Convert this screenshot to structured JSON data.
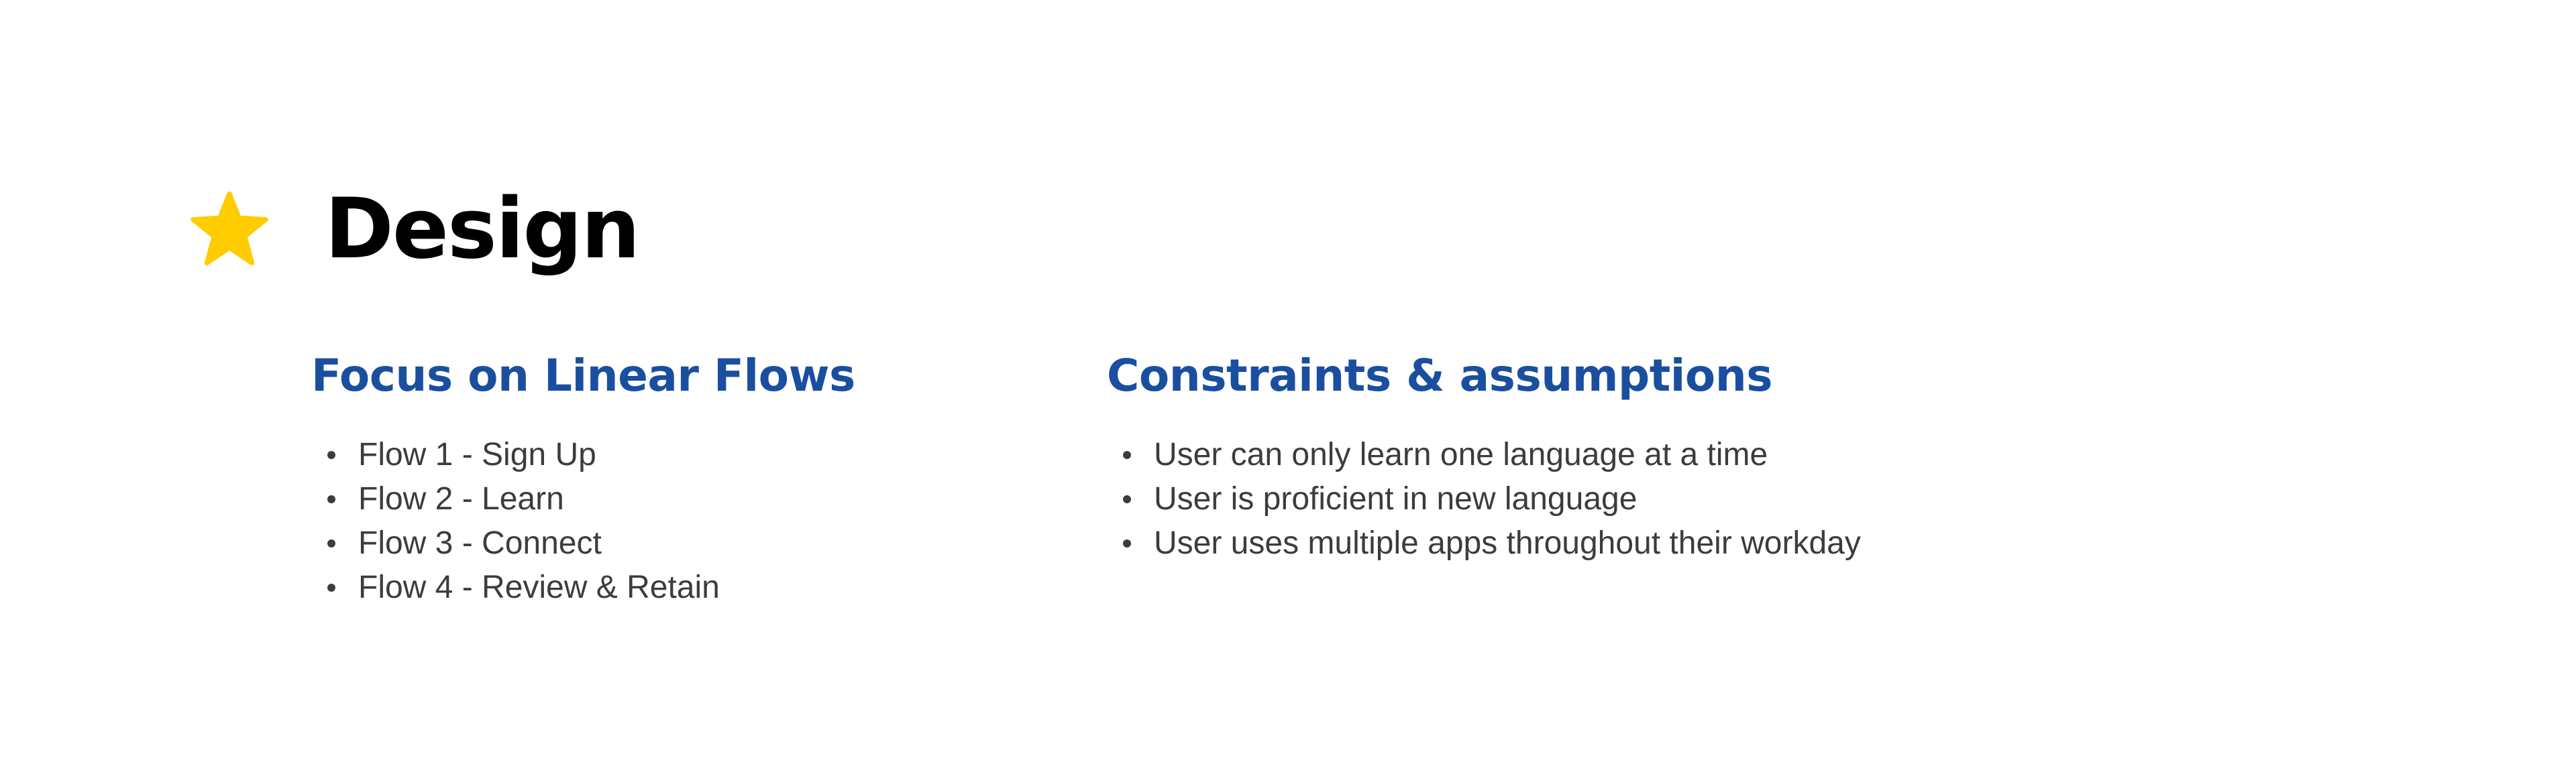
{
  "header": {
    "icon": "star-icon",
    "icon_color": "#FFCC00",
    "title": "Design"
  },
  "sections": [
    {
      "heading": "Focus on Linear Flows",
      "heading_color": "#1A4FA0",
      "items": [
        "Flow 1 - Sign Up",
        "Flow 2 - Learn",
        "Flow 3 - Connect",
        "Flow 4 - Review & Retain"
      ]
    },
    {
      "heading": "Constraints & assumptions",
      "heading_color": "#1A4FA0",
      "items": [
        "User can only learn one language at a time",
        "User is proficient in new language",
        "User uses multiple apps throughout their workday"
      ]
    }
  ]
}
